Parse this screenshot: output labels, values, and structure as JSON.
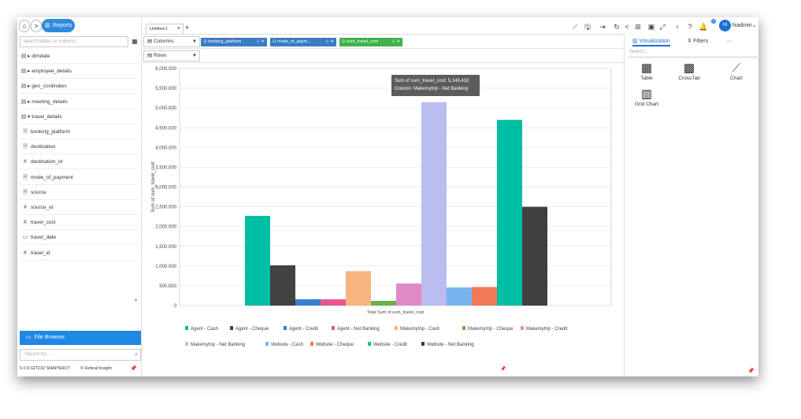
{
  "nav": {
    "home": "⌂",
    "forward": ">",
    "reports_label": "Reports"
  },
  "left": {
    "search_placeholder": "search tables or columns",
    "tree": [
      {
        "icon": "table",
        "label": "dimdate",
        "expanded": false
      },
      {
        "icon": "table",
        "label": "employee_details",
        "expanded": false
      },
      {
        "icon": "table",
        "label": "geo_cordinates",
        "expanded": false
      },
      {
        "icon": "table",
        "label": "meeting_details",
        "expanded": false
      },
      {
        "icon": "table",
        "label": "travel_details",
        "expanded": true
      },
      {
        "icon": "text",
        "label": "booking_platform"
      },
      {
        "icon": "text",
        "label": "destination"
      },
      {
        "icon": "number",
        "label": "destination_id"
      },
      {
        "icon": "text",
        "label": "mode_of_payment"
      },
      {
        "icon": "text",
        "label": "source"
      },
      {
        "icon": "number",
        "label": "source_id"
      },
      {
        "icon": "number",
        "label": "travel_cost"
      },
      {
        "icon": "date",
        "label": "travel_date"
      },
      {
        "icon": "number",
        "label": "travel_id"
      }
    ],
    "file_browser_label": "File Browser",
    "search_for_placeholder": "Search for...",
    "version": "5.0.0.GIT232 SNAPSHOT",
    "brand": "Helical Insight"
  },
  "tabs": {
    "active_tab": "Untitled 1",
    "add": "+"
  },
  "shelves": {
    "columns_label": "Columns",
    "rows_label": "Rows",
    "pills": [
      {
        "label": "booking_platform",
        "color": "#3a7bc8"
      },
      {
        "label": "mode_of_paym...",
        "color": "#3a7bc8"
      },
      {
        "label": "sum_travel_cost",
        "color": "#3fb24a"
      }
    ]
  },
  "user": {
    "initials": "HI",
    "name": "hiadmin",
    "notif_count": "1"
  },
  "right": {
    "tab_visualization": "Visualization",
    "tab_filters": "Filters",
    "tab_more": "···",
    "search_placeholder": "Search...",
    "viz_types": [
      "Table",
      "CrossTab",
      "Chart",
      "Grid Chart"
    ]
  },
  "tooltip": {
    "line1": "Sum of sum_travel_cost: 5,149,416",
    "line2": "Column: Makemytrip - Net Banking"
  },
  "chart_data": {
    "type": "bar",
    "title": "",
    "xlabel": "Total Sum of sum_travel_cost",
    "ylabel": "Sum of sum_travel_cost",
    "ylim": [
      0,
      6000000
    ],
    "yticks": [
      "0",
      "500,000",
      "1,000,000",
      "1,500,000",
      "2,000,000",
      "2,500,000",
      "3,000,000",
      "3,500,000",
      "4,000,000",
      "4,500,000",
      "5,000,000",
      "5,500,000",
      "6,000,000"
    ],
    "grid": true,
    "legend_placement": "bottom",
    "series": [
      {
        "name": "Agent - Cash",
        "value": 2270000,
        "color": "#00bfa5"
      },
      {
        "name": "Agent - Cheque",
        "value": 1020000,
        "color": "#424242"
      },
      {
        "name": "Agent - Credit",
        "value": 160000,
        "color": "#3a7fd6"
      },
      {
        "name": "Agent - Net Banking",
        "value": 160000,
        "color": "#e8568d"
      },
      {
        "name": "Makemytrip - Cash",
        "value": 870000,
        "color": "#f6b47f"
      },
      {
        "name": "Makemytrip - Cheque",
        "value": 120000,
        "color": "#6ab04c"
      },
      {
        "name": "Makemytrip - Credit",
        "value": 560000,
        "color": "#e08ac7"
      },
      {
        "name": "Makemytrip - Net Banking",
        "value": 5149416,
        "color": "#b9bdf0"
      },
      {
        "name": "Website - Cash",
        "value": 460000,
        "color": "#79b4ef"
      },
      {
        "name": "Website - Cheque",
        "value": 470000,
        "color": "#f07a55"
      },
      {
        "name": "Website - Credit",
        "value": 4700000,
        "color": "#00bfa5"
      },
      {
        "name": "Website - Net Banking",
        "value": 2500000,
        "color": "#3f3f3f"
      }
    ]
  }
}
